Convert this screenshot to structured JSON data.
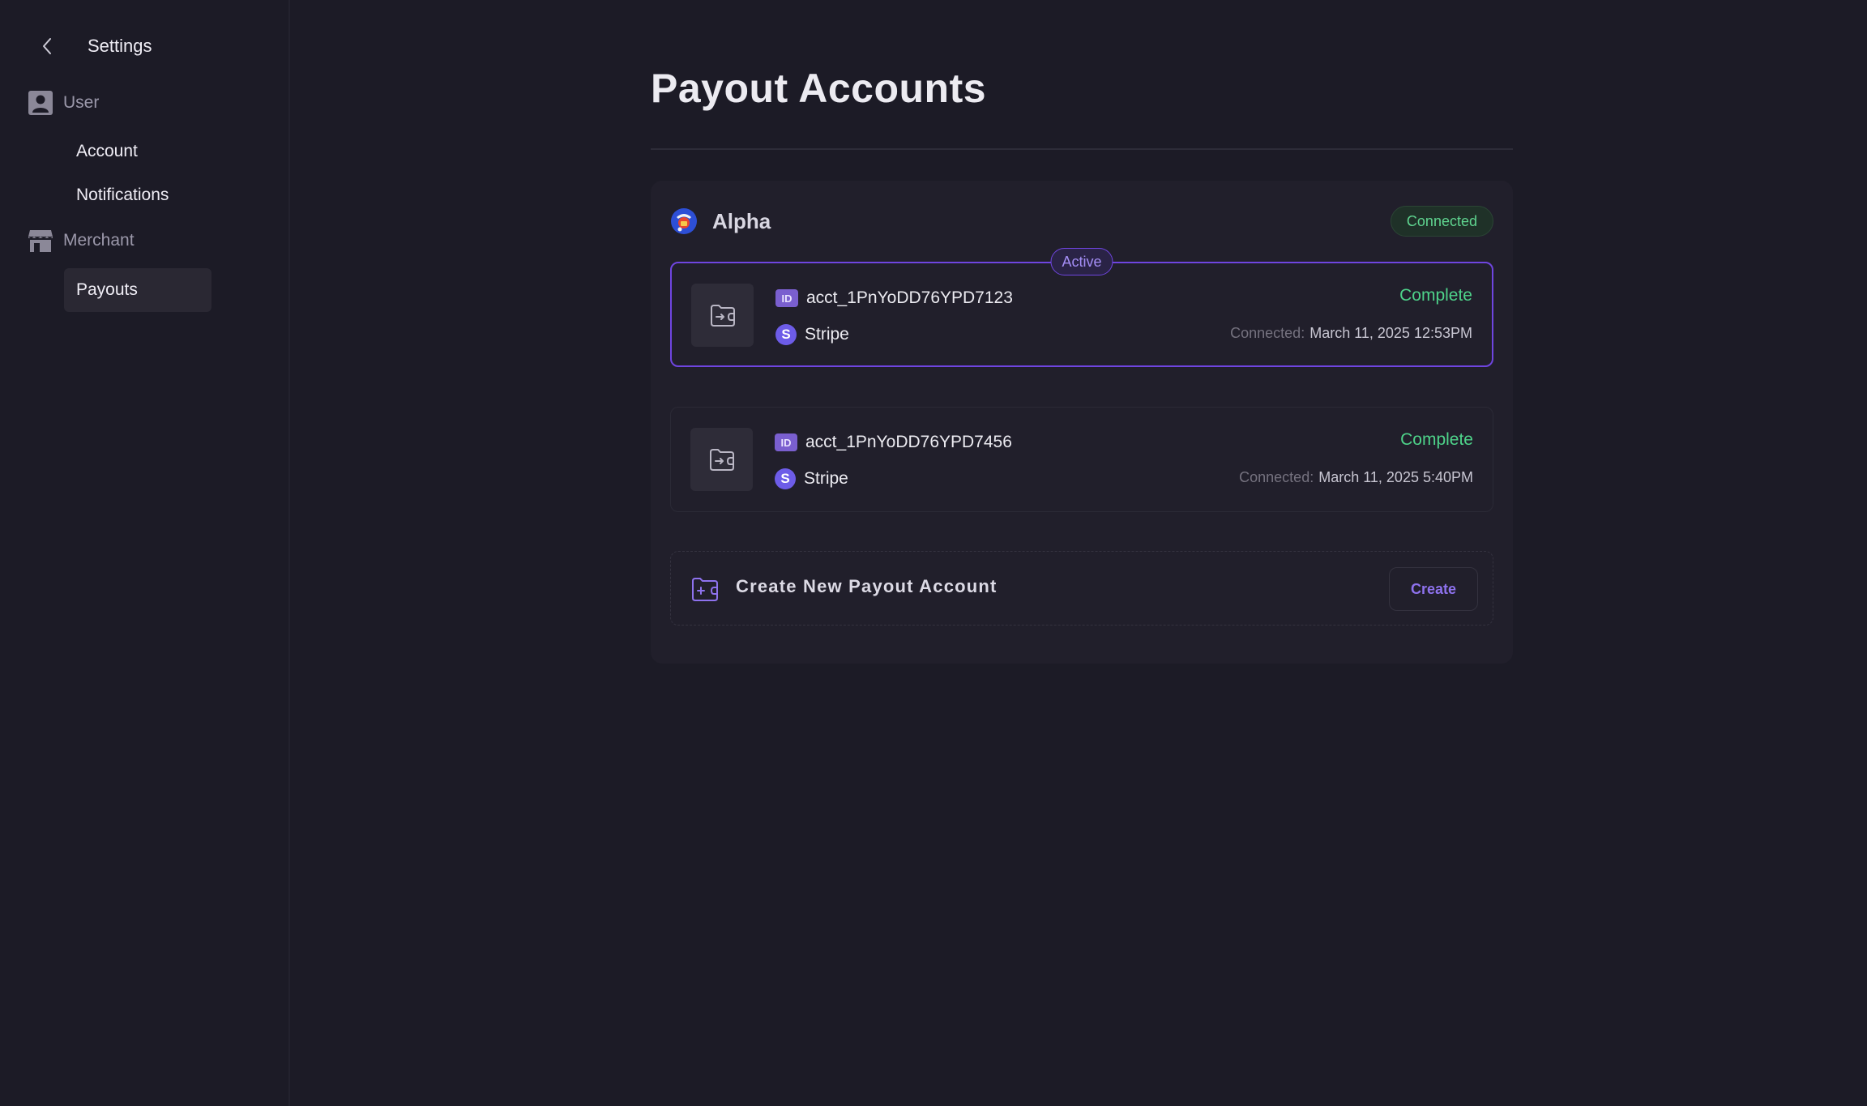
{
  "sidebar": {
    "title": "Settings",
    "groups": [
      {
        "label": "User",
        "items": [
          {
            "label": "Account"
          },
          {
            "label": "Notifications"
          }
        ]
      },
      {
        "label": "Merchant",
        "items": [
          {
            "label": "Payouts",
            "active": true
          }
        ]
      }
    ]
  },
  "main": {
    "title": "Payout Accounts",
    "provider": {
      "name": "Alpha",
      "status": "Connected",
      "accounts": [
        {
          "active_label": "Active",
          "id": "acct_1PnYoDD76YPD7123",
          "id_chip": "ID",
          "provider": "Stripe",
          "provider_icon_letter": "S",
          "status": "Complete",
          "connected_label": "Connected:",
          "connected_date": "March 11, 2025 12:53PM"
        },
        {
          "id": "acct_1PnYoDD76YPD7456",
          "id_chip": "ID",
          "provider": "Stripe",
          "provider_icon_letter": "S",
          "status": "Complete",
          "connected_label": "Connected:",
          "connected_date": "March 11, 2025 5:40PM"
        }
      ],
      "create": {
        "label": "Create New Payout Account",
        "button": "Create"
      }
    }
  },
  "colors": {
    "background": "#1c1b26",
    "panel": "#211f2b",
    "accent": "#6f45e0",
    "success": "#4ed38a"
  },
  "icons": [
    "chevron-left-icon",
    "user-icon",
    "store-icon",
    "wallet-icon",
    "id-icon",
    "stripe-icon",
    "add-wallet-icon",
    "alpha-logo-icon"
  ]
}
